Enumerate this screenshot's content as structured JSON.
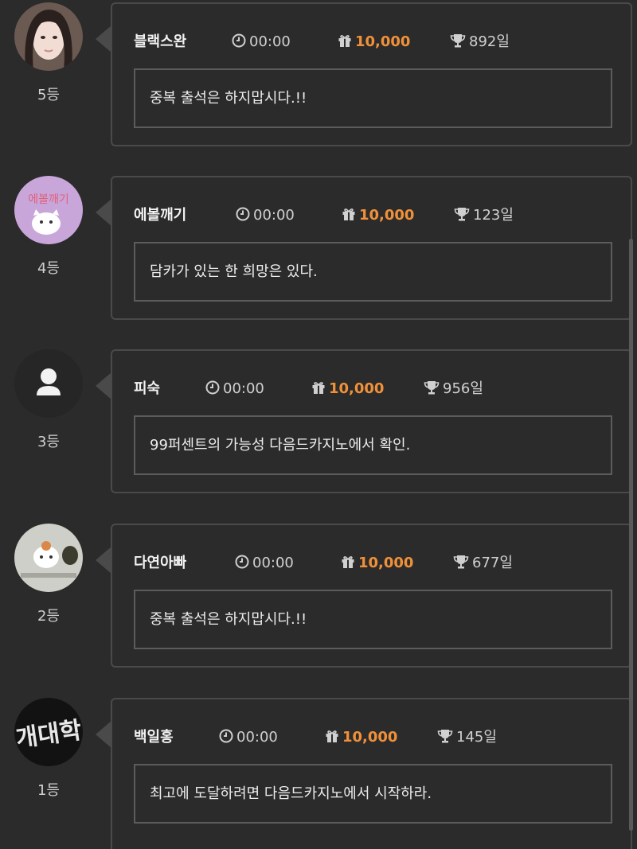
{
  "entries": [
    {
      "name": "블랙스완",
      "time": "00:00",
      "amount": "10,000",
      "days": "892일",
      "message": "중복 출석은 하지맙시다.!!",
      "rank": "5등",
      "avatar": "girl-photo-avatar"
    },
    {
      "name": "에볼깨기",
      "time": "00:00",
      "amount": "10,000",
      "days": "123일",
      "message": "담카가 있는 한 희망은 있다.",
      "rank": "4등",
      "avatar": "cat-sticker-avatar"
    },
    {
      "name": "피숙",
      "time": "00:00",
      "amount": "10,000",
      "days": "956일",
      "message": "99퍼센트의 가능성 다음드카지노에서 확인.",
      "rank": "3등",
      "avatar": "default-user-avatar"
    },
    {
      "name": "다연아빠",
      "time": "00:00",
      "amount": "10,000",
      "days": "677일",
      "message": "중복 출석은 하지맙시다.!!",
      "rank": "2등",
      "avatar": "hamster-cat-avatar"
    },
    {
      "name": "백일홍",
      "time": "00:00",
      "amount": "10,000",
      "days": "145일",
      "message": "최고에 도달하려면 다음드카지노에서 시작하라.",
      "rank": "1등",
      "avatar": "neon-text-avatar"
    }
  ],
  "colors": {
    "accent": "#f0913a",
    "background": "#2b2b2b",
    "border": "#4a4a4a"
  },
  "icons": {
    "time": "clock-icon",
    "amount": "gift-icon",
    "days": "trophy-icon"
  }
}
